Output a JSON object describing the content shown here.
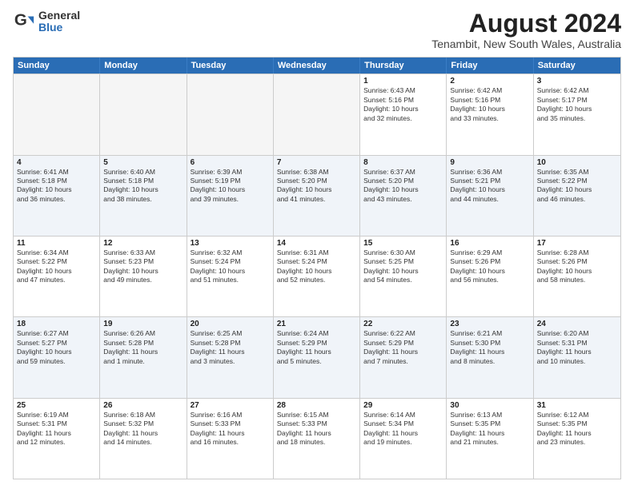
{
  "logo": {
    "general": "General",
    "blue": "Blue"
  },
  "title": "August 2024",
  "subtitle": "Tenambit, New South Wales, Australia",
  "days": [
    "Sunday",
    "Monday",
    "Tuesday",
    "Wednesday",
    "Thursday",
    "Friday",
    "Saturday"
  ],
  "weeks": [
    [
      {
        "day": "",
        "text": "",
        "empty": true
      },
      {
        "day": "",
        "text": "",
        "empty": true
      },
      {
        "day": "",
        "text": "",
        "empty": true
      },
      {
        "day": "",
        "text": "",
        "empty": true
      },
      {
        "day": "1",
        "text": "Sunrise: 6:43 AM\nSunset: 5:16 PM\nDaylight: 10 hours\nand 32 minutes.",
        "empty": false
      },
      {
        "day": "2",
        "text": "Sunrise: 6:42 AM\nSunset: 5:16 PM\nDaylight: 10 hours\nand 33 minutes.",
        "empty": false
      },
      {
        "day": "3",
        "text": "Sunrise: 6:42 AM\nSunset: 5:17 PM\nDaylight: 10 hours\nand 35 minutes.",
        "empty": false
      }
    ],
    [
      {
        "day": "4",
        "text": "Sunrise: 6:41 AM\nSunset: 5:18 PM\nDaylight: 10 hours\nand 36 minutes.",
        "empty": false
      },
      {
        "day": "5",
        "text": "Sunrise: 6:40 AM\nSunset: 5:18 PM\nDaylight: 10 hours\nand 38 minutes.",
        "empty": false
      },
      {
        "day": "6",
        "text": "Sunrise: 6:39 AM\nSunset: 5:19 PM\nDaylight: 10 hours\nand 39 minutes.",
        "empty": false
      },
      {
        "day": "7",
        "text": "Sunrise: 6:38 AM\nSunset: 5:20 PM\nDaylight: 10 hours\nand 41 minutes.",
        "empty": false
      },
      {
        "day": "8",
        "text": "Sunrise: 6:37 AM\nSunset: 5:20 PM\nDaylight: 10 hours\nand 43 minutes.",
        "empty": false
      },
      {
        "day": "9",
        "text": "Sunrise: 6:36 AM\nSunset: 5:21 PM\nDaylight: 10 hours\nand 44 minutes.",
        "empty": false
      },
      {
        "day": "10",
        "text": "Sunrise: 6:35 AM\nSunset: 5:22 PM\nDaylight: 10 hours\nand 46 minutes.",
        "empty": false
      }
    ],
    [
      {
        "day": "11",
        "text": "Sunrise: 6:34 AM\nSunset: 5:22 PM\nDaylight: 10 hours\nand 47 minutes.",
        "empty": false
      },
      {
        "day": "12",
        "text": "Sunrise: 6:33 AM\nSunset: 5:23 PM\nDaylight: 10 hours\nand 49 minutes.",
        "empty": false
      },
      {
        "day": "13",
        "text": "Sunrise: 6:32 AM\nSunset: 5:24 PM\nDaylight: 10 hours\nand 51 minutes.",
        "empty": false
      },
      {
        "day": "14",
        "text": "Sunrise: 6:31 AM\nSunset: 5:24 PM\nDaylight: 10 hours\nand 52 minutes.",
        "empty": false
      },
      {
        "day": "15",
        "text": "Sunrise: 6:30 AM\nSunset: 5:25 PM\nDaylight: 10 hours\nand 54 minutes.",
        "empty": false
      },
      {
        "day": "16",
        "text": "Sunrise: 6:29 AM\nSunset: 5:26 PM\nDaylight: 10 hours\nand 56 minutes.",
        "empty": false
      },
      {
        "day": "17",
        "text": "Sunrise: 6:28 AM\nSunset: 5:26 PM\nDaylight: 10 hours\nand 58 minutes.",
        "empty": false
      }
    ],
    [
      {
        "day": "18",
        "text": "Sunrise: 6:27 AM\nSunset: 5:27 PM\nDaylight: 10 hours\nand 59 minutes.",
        "empty": false
      },
      {
        "day": "19",
        "text": "Sunrise: 6:26 AM\nSunset: 5:28 PM\nDaylight: 11 hours\nand 1 minute.",
        "empty": false
      },
      {
        "day": "20",
        "text": "Sunrise: 6:25 AM\nSunset: 5:28 PM\nDaylight: 11 hours\nand 3 minutes.",
        "empty": false
      },
      {
        "day": "21",
        "text": "Sunrise: 6:24 AM\nSunset: 5:29 PM\nDaylight: 11 hours\nand 5 minutes.",
        "empty": false
      },
      {
        "day": "22",
        "text": "Sunrise: 6:22 AM\nSunset: 5:29 PM\nDaylight: 11 hours\nand 7 minutes.",
        "empty": false
      },
      {
        "day": "23",
        "text": "Sunrise: 6:21 AM\nSunset: 5:30 PM\nDaylight: 11 hours\nand 8 minutes.",
        "empty": false
      },
      {
        "day": "24",
        "text": "Sunrise: 6:20 AM\nSunset: 5:31 PM\nDaylight: 11 hours\nand 10 minutes.",
        "empty": false
      }
    ],
    [
      {
        "day": "25",
        "text": "Sunrise: 6:19 AM\nSunset: 5:31 PM\nDaylight: 11 hours\nand 12 minutes.",
        "empty": false
      },
      {
        "day": "26",
        "text": "Sunrise: 6:18 AM\nSunset: 5:32 PM\nDaylight: 11 hours\nand 14 minutes.",
        "empty": false
      },
      {
        "day": "27",
        "text": "Sunrise: 6:16 AM\nSunset: 5:33 PM\nDaylight: 11 hours\nand 16 minutes.",
        "empty": false
      },
      {
        "day": "28",
        "text": "Sunrise: 6:15 AM\nSunset: 5:33 PM\nDaylight: 11 hours\nand 18 minutes.",
        "empty": false
      },
      {
        "day": "29",
        "text": "Sunrise: 6:14 AM\nSunset: 5:34 PM\nDaylight: 11 hours\nand 19 minutes.",
        "empty": false
      },
      {
        "day": "30",
        "text": "Sunrise: 6:13 AM\nSunset: 5:35 PM\nDaylight: 11 hours\nand 21 minutes.",
        "empty": false
      },
      {
        "day": "31",
        "text": "Sunrise: 6:12 AM\nSunset: 5:35 PM\nDaylight: 11 hours\nand 23 minutes.",
        "empty": false
      }
    ]
  ]
}
